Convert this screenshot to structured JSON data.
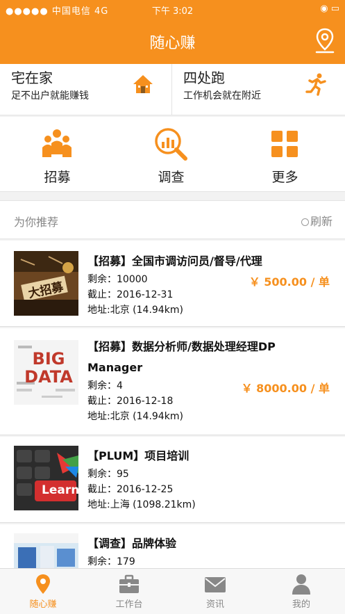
{
  "statusbar": {
    "signal": "●●●●● 中国电信 4G",
    "time": "下午 3:02",
    "right": "◉ ▭"
  },
  "header": {
    "title": "随心赚"
  },
  "quick": [
    {
      "title": "宅在家",
      "subtitle": "足不出户就能赚钱",
      "icon": "house-icon"
    },
    {
      "title": "四处跑",
      "subtitle": "工作机会就在附近",
      "icon": "running-person-icon"
    }
  ],
  "categories": [
    {
      "label": "招募",
      "icon": "people-group-icon"
    },
    {
      "label": "调查",
      "icon": "chart-magnifier-icon"
    },
    {
      "label": "更多",
      "icon": "grid-icon"
    }
  ],
  "recommend": {
    "title": "为你推荐",
    "refresh": "刷新"
  },
  "jobs": [
    {
      "title": "【招募】全国市调访问员/督导/代理",
      "title2": "",
      "remain": "剩余：10000",
      "deadline": "截止：2016-12-31",
      "address": "地址:北京 (14.94km)",
      "price": "￥ 500.00 / 单",
      "thumb_text": "大招募"
    },
    {
      "title": "【招募】数据分析师/数据处理经理DP",
      "title2": "Manager",
      "remain": "剩余：4",
      "deadline": "截止：2016-12-18",
      "address": "地址:北京 (14.94km)",
      "price": "￥ 8000.00 / 单",
      "thumb_text": "BIG DATA"
    },
    {
      "title": "【PLUM】项目培训",
      "title2": "",
      "remain": "剩余：95",
      "deadline": "截止：2016-12-25",
      "address": "地址:上海 (1098.21km)",
      "price": "",
      "thumb_text": "Learn"
    },
    {
      "title": "【调查】品牌体验",
      "title2": "",
      "remain": "剩余：179",
      "deadline": "",
      "address": "",
      "price": "",
      "thumb_text": ""
    }
  ],
  "tabs": [
    {
      "label": "随心赚",
      "icon": "location-pin-icon",
      "active": true
    },
    {
      "label": "工作台",
      "icon": "briefcase-icon",
      "active": false
    },
    {
      "label": "资讯",
      "icon": "envelope-icon",
      "active": false
    },
    {
      "label": "我的",
      "icon": "person-icon",
      "active": false
    }
  ],
  "colors": {
    "accent": "#f6901e"
  }
}
